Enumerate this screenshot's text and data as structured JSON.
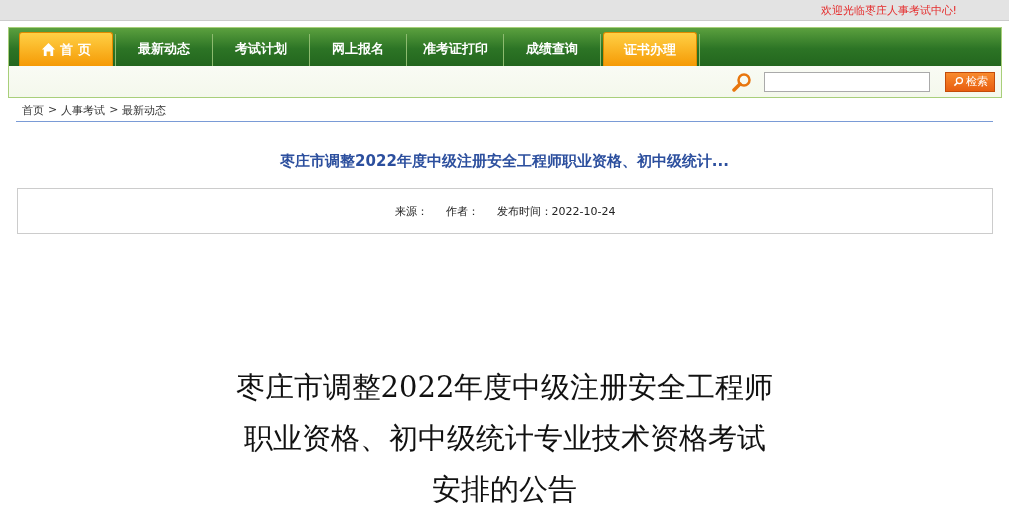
{
  "welcome": "欢迎光临枣庄人事考试中心!",
  "nav": [
    {
      "label": "首 页",
      "selected": true,
      "kind": "home"
    },
    {
      "label": "最新动态",
      "selected": false,
      "kind": "text"
    },
    {
      "label": "考试计划",
      "selected": false,
      "kind": "text"
    },
    {
      "label": "网上报名",
      "selected": false,
      "kind": "text"
    },
    {
      "label": "准考证打印",
      "selected": false,
      "kind": "text"
    },
    {
      "label": "成绩查询",
      "selected": false,
      "kind": "text"
    },
    {
      "label": "证书办理",
      "selected": true,
      "kind": "text"
    }
  ],
  "search": {
    "button": "检索"
  },
  "breadcrumb": {
    "items": [
      "首页",
      "人事考试",
      "最新动态"
    ],
    "separator": ">"
  },
  "article": {
    "title": "枣庄市调整2022年度中级注册安全工程师职业资格、初中级统计...",
    "meta": [
      "来源：",
      "作者：",
      "发布时间：2022-10-24"
    ],
    "heading_lines": [
      "枣庄市调整2022年度中级注册安全工程师",
      "职业资格、初中级统计专业技术资格考试",
      "安排的公告"
    ]
  }
}
